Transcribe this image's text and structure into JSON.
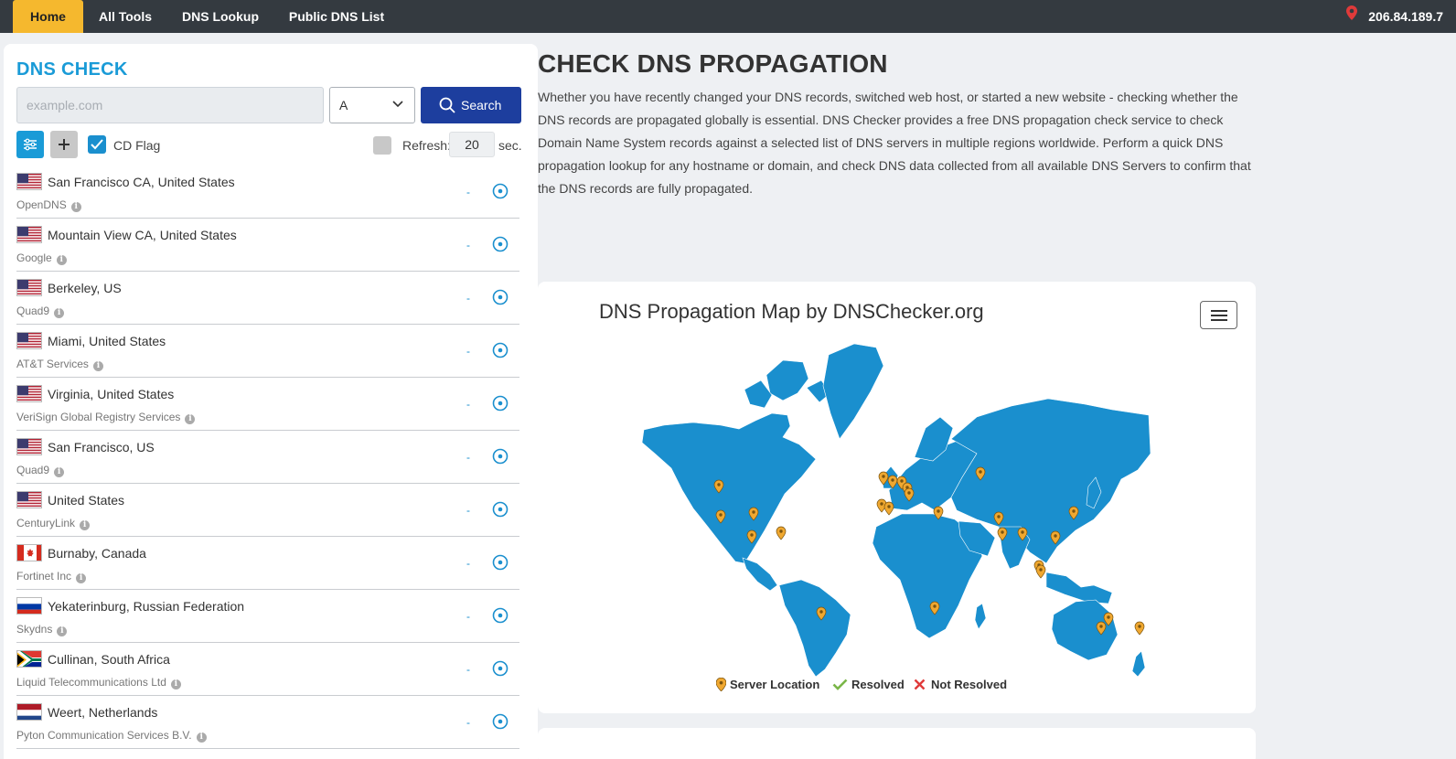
{
  "nav": {
    "items": [
      {
        "label": "Home",
        "active": true
      },
      {
        "label": "All Tools",
        "active": false
      },
      {
        "label": "DNS Lookup",
        "active": false
      },
      {
        "label": "Public DNS List",
        "active": false
      }
    ],
    "ip": "206.84.189.7"
  },
  "check": {
    "title": "DNS CHECK",
    "placeholder": "example.com",
    "record_type": "A",
    "search_label": "Search",
    "cd_flag_label": "CD Flag",
    "cd_flag_checked": true,
    "refresh_label": "Refresh:",
    "refresh_value": "20",
    "refresh_unit": "sec."
  },
  "servers": [
    {
      "flag": "us",
      "location": "San Francisco CA, United States",
      "provider": "OpenDNS",
      "result": "-"
    },
    {
      "flag": "us",
      "location": "Mountain View CA, United States",
      "provider": "Google",
      "result": "-"
    },
    {
      "flag": "us",
      "location": "Berkeley, US",
      "provider": "Quad9",
      "result": "-"
    },
    {
      "flag": "us",
      "location": "Miami, United States",
      "provider": "AT&T Services",
      "result": "-"
    },
    {
      "flag": "us",
      "location": "Virginia, United States",
      "provider": "VeriSign Global Registry Services",
      "result": "-"
    },
    {
      "flag": "us",
      "location": "San Francisco, US",
      "provider": "Quad9",
      "result": "-"
    },
    {
      "flag": "us",
      "location": "United States",
      "provider": "CenturyLink",
      "result": "-"
    },
    {
      "flag": "ca",
      "location": "Burnaby, Canada",
      "provider": "Fortinet Inc",
      "result": "-"
    },
    {
      "flag": "ru",
      "location": "Yekaterinburg, Russian Federation",
      "provider": "Skydns",
      "result": "-"
    },
    {
      "flag": "za",
      "location": "Cullinan, South Africa",
      "provider": "Liquid Telecommunications Ltd",
      "result": "-"
    },
    {
      "flag": "nl",
      "location": "Weert, Netherlands",
      "provider": "Pyton Communication Services B.V.",
      "result": "-"
    }
  ],
  "main": {
    "title": "CHECK DNS PROPAGATION",
    "description": "Whether you have recently changed your DNS records, switched web host, or started a new website - checking whether the DNS records are propagated globally is essential. DNS Checker provides a free DNS propagation check service to check Domain Name System records against a selected list of DNS servers in multiple regions worldwide. Perform a quick DNS propagation lookup for any hostname or domain, and check DNS data collected from all available DNS Servers to confirm that the DNS records are fully propagated."
  },
  "map": {
    "title": "DNS Propagation Map by DNSChecker.org",
    "land_color": "#1a8fce",
    "marker_color": "#f0a830",
    "legend": {
      "server_location": "Server Location",
      "resolved": "Resolved",
      "not_resolved": "Not Resolved"
    }
  },
  "colors": {
    "nav_bg": "#343a40",
    "nav_active": "#f5b82e",
    "accent": "#1a9bd7",
    "search_button": "#1d3e9e",
    "resolved": "#7ab648",
    "not_resolved": "#e03a3a"
  }
}
